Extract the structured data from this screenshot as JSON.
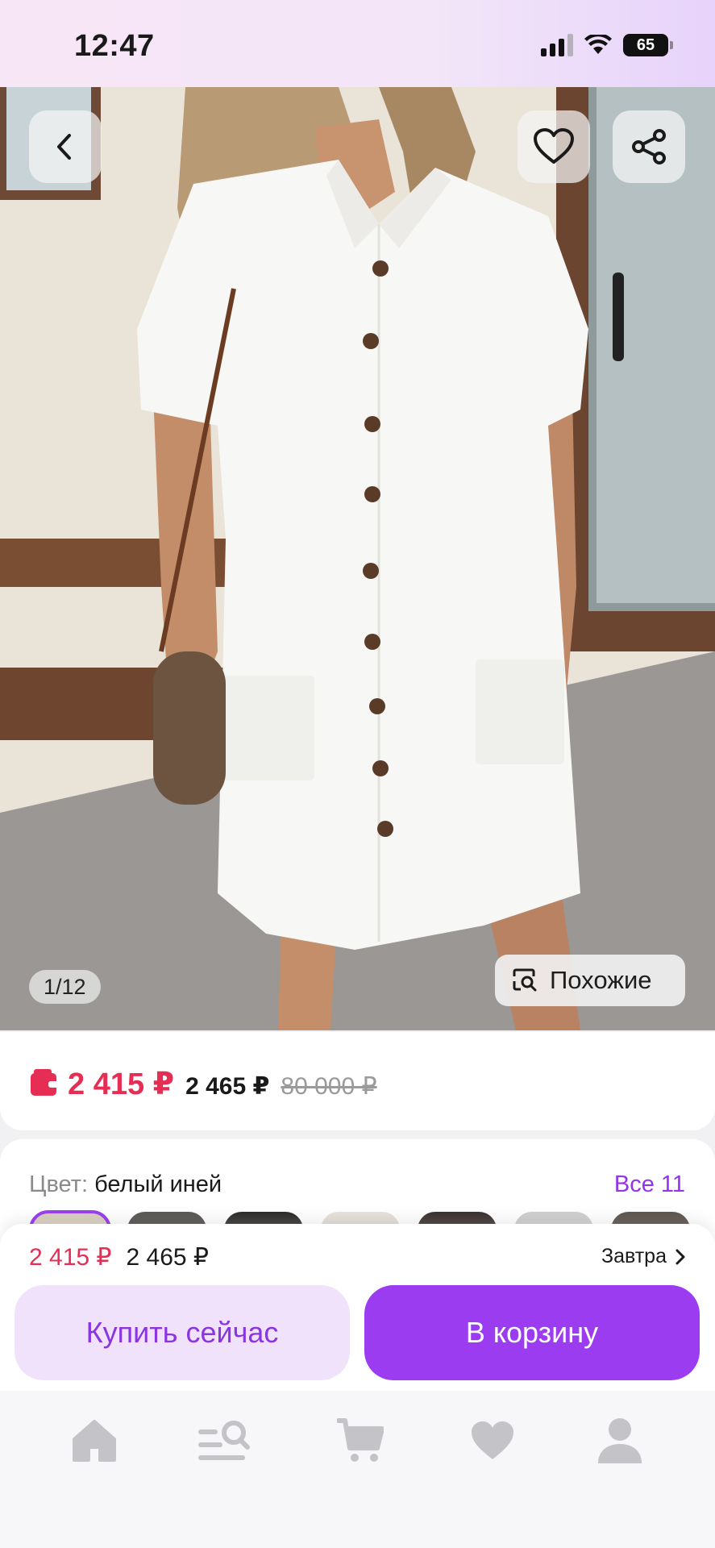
{
  "status_bar": {
    "time": "12:47",
    "battery": "65"
  },
  "gallery": {
    "counter": "1/12",
    "similar_label": "Похожие",
    "icons": {
      "back": "chevron-left-icon",
      "favorite": "heart-outline-icon",
      "share": "share-icon",
      "similar": "image-search-icon"
    }
  },
  "price_card": {
    "price_wallet": "2 415 ₽",
    "price_regular": "2 465 ₽",
    "price_old": "80 000 ₽",
    "price_color": "#e62e54"
  },
  "color_selector": {
    "label": "Цвет:",
    "value": "белый иней",
    "all_link": "Все 11"
  },
  "buy_bar": {
    "price_wallet": "2 415 ₽",
    "price_regular": "2 465 ₽",
    "delivery": "Завтра",
    "buy_now_label": "Купить сейчас",
    "add_to_cart_label": "В корзину",
    "accent_color": "#9b3cf0"
  },
  "tab_bar": {
    "items": [
      {
        "icon": "home-icon"
      },
      {
        "icon": "catalog-search-icon"
      },
      {
        "icon": "cart-icon"
      },
      {
        "icon": "heart-icon"
      },
      {
        "icon": "profile-icon"
      }
    ]
  }
}
